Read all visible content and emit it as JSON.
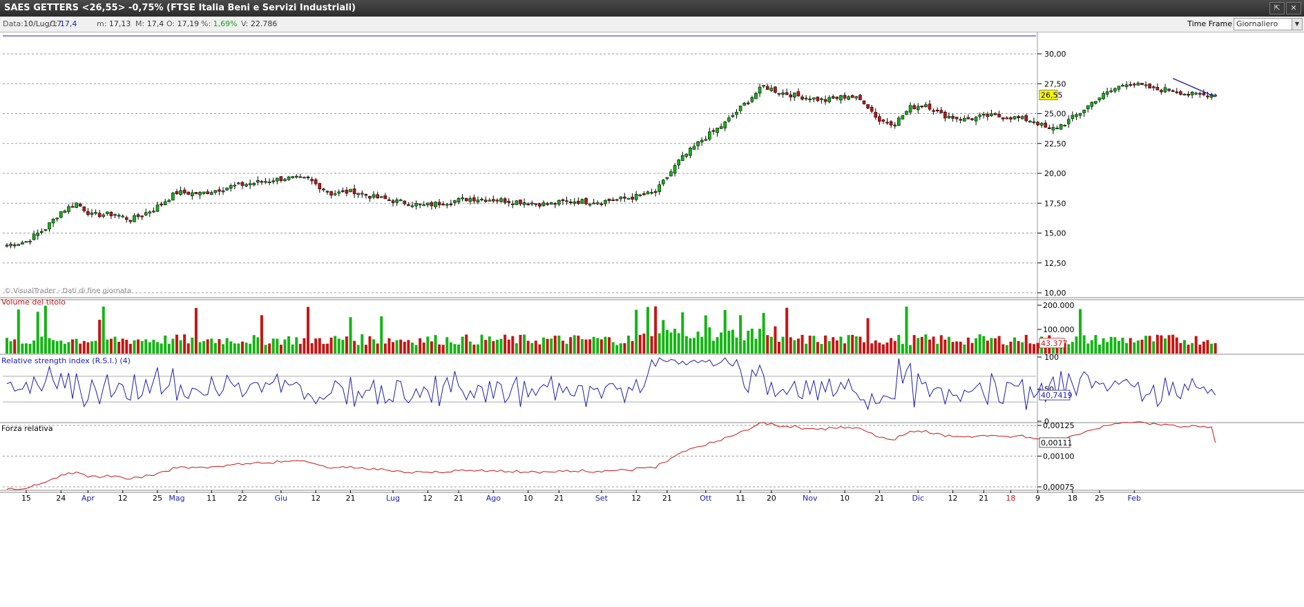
{
  "window": {
    "title": "SAES GETTERS <26,55> -0,75%  (FTSE Italia Beni e Servizi Industriali)",
    "buttons": [
      "⇱",
      "✕"
    ]
  },
  "info": {
    "data_label": "Data:",
    "data_value": "10/Lug/17",
    "c_label": "C:",
    "c_value": "17,4",
    "m_label": "m:",
    "m_value": "17,13",
    "M_label": "M:",
    "M_value": "17,4",
    "o_label": "O:",
    "o_value": "17,19",
    "pct_label": "%:",
    "pct_value": "1,69%",
    "v_label": "V:",
    "v_value": "22.786",
    "timeframe_label": "Time Frame",
    "timeframe_value": "Giornaliero"
  },
  "colors": {
    "up": "#13b513",
    "down": "#c81414",
    "rsi": "#1c1cb4",
    "forza": "#c81414",
    "price_label_bg": "#ffff00",
    "trend": "#1c1cb4"
  },
  "chart_data": [
    {
      "type": "candlestick",
      "panel": "price",
      "watermark": "© VisualTrader - Dati di fine giornata",
      "ylim": [
        10,
        31.5
      ],
      "yticks": [
        "30,00",
        "27,50",
        "25,00",
        "22,50",
        "20,00",
        "17,50",
        "15,00",
        "12,50",
        "10,00"
      ],
      "ytick_values": [
        30,
        27.5,
        25,
        22.5,
        20,
        17.5,
        15,
        12.5,
        10
      ],
      "last_value_label": "26,55",
      "x_range": [
        0,
        313
      ],
      "trendline": [
        [
          302,
          27.95
        ],
        [
          313,
          26.4
        ]
      ],
      "close_anchors": [
        [
          0,
          14.0
        ],
        [
          5,
          14.3
        ],
        [
          10,
          15.4
        ],
        [
          14,
          16.8
        ],
        [
          18,
          17.5
        ],
        [
          22,
          16.5
        ],
        [
          28,
          16.6
        ],
        [
          32,
          16.1
        ],
        [
          38,
          17.0
        ],
        [
          44,
          18.4
        ],
        [
          50,
          18.3
        ],
        [
          58,
          18.9
        ],
        [
          64,
          19.2
        ],
        [
          72,
          19.6
        ],
        [
          78,
          19.5
        ],
        [
          84,
          18.3
        ],
        [
          90,
          18.5
        ],
        [
          95,
          18.0
        ],
        [
          102,
          17.6
        ],
        [
          108,
          17.3
        ],
        [
          114,
          17.6
        ],
        [
          120,
          17.9
        ],
        [
          126,
          17.8
        ],
        [
          134,
          17.6
        ],
        [
          140,
          17.4
        ],
        [
          146,
          17.7
        ],
        [
          152,
          17.6
        ],
        [
          158,
          17.8
        ],
        [
          162,
          18.0
        ],
        [
          168,
          18.4
        ],
        [
          174,
          21.0
        ],
        [
          180,
          22.8
        ],
        [
          186,
          24.2
        ],
        [
          192,
          26.1
        ],
        [
          196,
          27.3
        ],
        [
          200,
          26.8
        ],
        [
          206,
          26.4
        ],
        [
          212,
          26.1
        ],
        [
          218,
          26.5
        ],
        [
          222,
          26.0
        ],
        [
          226,
          24.4
        ],
        [
          230,
          24.2
        ],
        [
          234,
          25.5
        ],
        [
          238,
          25.8
        ],
        [
          242,
          24.9
        ],
        [
          248,
          24.5
        ],
        [
          254,
          24.8
        ],
        [
          260,
          24.7
        ],
        [
          266,
          24.4
        ],
        [
          270,
          23.6
        ],
        [
          274,
          24.2
        ],
        [
          278,
          25.1
        ],
        [
          282,
          26.2
        ],
        [
          286,
          26.9
        ],
        [
          290,
          27.6
        ],
        [
          294,
          27.3
        ],
        [
          298,
          27.0
        ],
        [
          302,
          27.0
        ],
        [
          306,
          26.6
        ],
        [
          310,
          26.55
        ]
      ],
      "seed": 7
    },
    {
      "type": "bar",
      "panel": "volume",
      "title": "Volume del titolo",
      "ylim": [
        0,
        220000
      ],
      "yticks": [
        "200.000",
        "100.000"
      ],
      "ytick_values": [
        200000,
        100000
      ],
      "last_value_label": "43.377",
      "spike_indices": [
        3,
        8,
        10,
        24,
        25,
        49,
        66,
        78,
        89,
        97,
        163,
        166,
        168,
        170,
        175,
        181,
        186,
        190,
        196,
        202,
        223,
        233,
        278
      ],
      "base_level": 35000
    },
    {
      "type": "line",
      "panel": "rsi",
      "title": "Relative strength index (R.S.I.) (4)",
      "ylim": [
        0,
        100
      ],
      "yticks": [
        "100",
        "50",
        "0"
      ],
      "ytick_values": [
        100,
        50,
        0
      ],
      "levels": [
        70,
        30
      ],
      "last_value_label": "40,7419"
    },
    {
      "type": "line",
      "panel": "forza",
      "title": "Forza relativa",
      "ylim": [
        0.00071,
        0.00129
      ],
      "yticks": [
        "0,00125",
        "0,00100",
        "0,00075"
      ],
      "ytick_values": [
        0.00125,
        0.001,
        0.00075
      ],
      "last_value_label": "0,00111"
    }
  ],
  "xaxis": {
    "labels": [
      {
        "t": "15",
        "i": 5,
        "c": "k"
      },
      {
        "t": "24",
        "i": 14,
        "c": "k"
      },
      {
        "t": "Apr",
        "i": 21,
        "c": "b"
      },
      {
        "t": "12",
        "i": 30,
        "c": "k"
      },
      {
        "t": "25",
        "i": 39,
        "c": "k"
      },
      {
        "t": "Mag",
        "i": 44,
        "c": "b"
      },
      {
        "t": "11",
        "i": 53,
        "c": "k"
      },
      {
        "t": "22",
        "i": 61,
        "c": "k"
      },
      {
        "t": "Giu",
        "i": 71,
        "c": "b"
      },
      {
        "t": "12",
        "i": 80,
        "c": "k"
      },
      {
        "t": "21",
        "i": 89,
        "c": "k"
      },
      {
        "t": "Lug",
        "i": 100,
        "c": "b"
      },
      {
        "t": "12",
        "i": 109,
        "c": "k"
      },
      {
        "t": "21",
        "i": 117,
        "c": "k"
      },
      {
        "t": "Ago",
        "i": 126,
        "c": "b"
      },
      {
        "t": "10",
        "i": 135,
        "c": "k"
      },
      {
        "t": "21",
        "i": 143,
        "c": "k"
      },
      {
        "t": "Set",
        "i": 154,
        "c": "b"
      },
      {
        "t": "12",
        "i": 163,
        "c": "k"
      },
      {
        "t": "21",
        "i": 171,
        "c": "k"
      },
      {
        "t": "Ott",
        "i": 181,
        "c": "b"
      },
      {
        "t": "11",
        "i": 190,
        "c": "k"
      },
      {
        "t": "20",
        "i": 198,
        "c": "k"
      },
      {
        "t": "Nov",
        "i": 208,
        "c": "b"
      },
      {
        "t": "10",
        "i": 217,
        "c": "k"
      },
      {
        "t": "21",
        "i": 226,
        "c": "k"
      },
      {
        "t": "Dic",
        "i": 236,
        "c": "b"
      },
      {
        "t": "12",
        "i": 245,
        "c": "k"
      },
      {
        "t": "21",
        "i": 253,
        "c": "k"
      },
      {
        "t": "18",
        "i": 260,
        "c": "r"
      },
      {
        "t": "9",
        "i": 267,
        "c": "k"
      },
      {
        "t": "18",
        "i": 276,
        "c": "k"
      },
      {
        "t": "25",
        "i": 283,
        "c": "k"
      },
      {
        "t": "Feb",
        "i": 292,
        "c": "b"
      }
    ]
  }
}
